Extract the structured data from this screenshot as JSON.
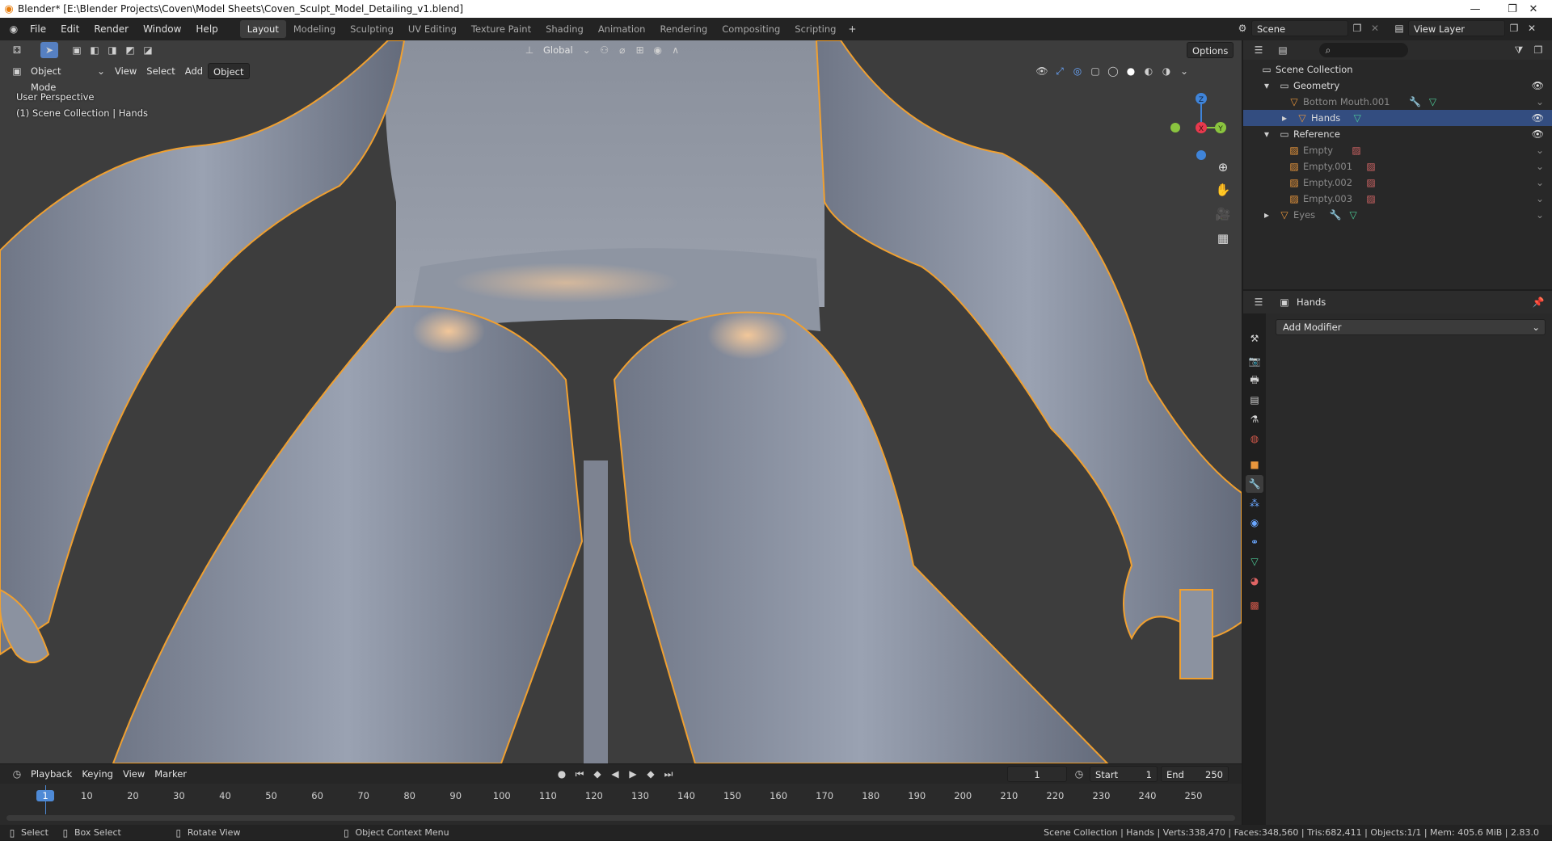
{
  "window": {
    "title": "Blender* [E:\\Blender Projects\\Coven\\Model Sheets\\Coven_Sculpt_Model_Detailing_v1.blend]"
  },
  "menu": [
    "File",
    "Edit",
    "Render",
    "Window",
    "Help"
  ],
  "workspaces": [
    "Layout",
    "Modeling",
    "Sculpting",
    "UV Editing",
    "Texture Paint",
    "Shading",
    "Animation",
    "Rendering",
    "Compositing",
    "Scripting"
  ],
  "active_workspace": "Layout",
  "scene": {
    "scene_name": "Scene",
    "view_layer": "View Layer"
  },
  "viewport": {
    "transform_orientation": "Global",
    "options_label": "Options",
    "mode": "Object Mode",
    "header_menus": [
      "View",
      "Select",
      "Add",
      "Object"
    ],
    "perspective_label": "User Perspective",
    "collection_label": "(1) Scene Collection | Hands",
    "gizmo": {
      "z": "Z",
      "x": "X",
      "y": "Y"
    }
  },
  "timeline": {
    "menus": [
      "Playback",
      "Keying",
      "View",
      "Marker"
    ],
    "current_frame": "1",
    "start_label": "Start",
    "start": "1",
    "end_label": "End",
    "end": "250",
    "ticks": [
      "1",
      "10",
      "20",
      "30",
      "40",
      "50",
      "60",
      "70",
      "80",
      "90",
      "100",
      "110",
      "120",
      "130",
      "140",
      "150",
      "160",
      "170",
      "180",
      "190",
      "200",
      "210",
      "220",
      "230",
      "240",
      "250"
    ]
  },
  "outliner": {
    "root": "Scene Collection",
    "rows": [
      {
        "label": "Geometry"
      },
      {
        "label": "Bottom Mouth.001"
      },
      {
        "label": "Hands"
      },
      {
        "label": "Reference"
      },
      {
        "label": "Empty"
      },
      {
        "label": "Empty.001"
      },
      {
        "label": "Empty.002"
      },
      {
        "label": "Empty.003"
      },
      {
        "label": "Eyes"
      }
    ]
  },
  "properties": {
    "object_name": "Hands",
    "add_modifier": "Add Modifier"
  },
  "statusbar": {
    "select": "Select",
    "box_select": "Box Select",
    "rotate_view": "Rotate View",
    "context_menu": "Object Context Menu",
    "stats": "Scene Collection | Hands | Verts:338,470 | Faces:348,560 | Tris:682,411 | Objects:1/1 | Mem: 405.6 MiB | 2.83.0"
  },
  "colors": {
    "selection_outline": "#f0a030",
    "viewport_bg": "#3d3d3d",
    "active_blue": "#5680c2",
    "axis_x": "#e8394d",
    "axis_y": "#8ac43f",
    "axis_z": "#3f84d9"
  }
}
